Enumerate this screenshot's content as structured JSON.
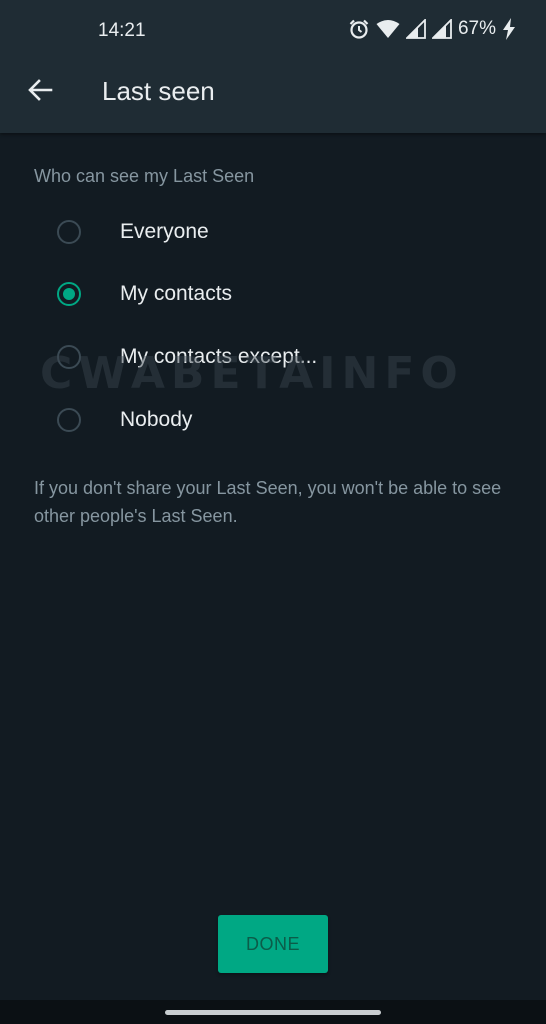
{
  "status_bar": {
    "time": "14:21",
    "battery": "67%",
    "icons": [
      "alarm-icon",
      "wifi-icon",
      "signal-icon",
      "signal-icon",
      "charging-icon"
    ]
  },
  "app_bar": {
    "title": "Last seen",
    "back_icon": "arrow-left-icon"
  },
  "section": {
    "label": "Who can see my Last Seen"
  },
  "options": [
    {
      "label": "Everyone",
      "selected": false
    },
    {
      "label": "My contacts",
      "selected": true
    },
    {
      "label": "My contacts except...",
      "selected": false
    },
    {
      "label": "Nobody",
      "selected": false
    }
  ],
  "footnote": "If you don't share your Last Seen, you won't be able to see other people's Last Seen.",
  "watermark": "CWABETAINFO",
  "done_button": "DONE",
  "colors": {
    "background": "#121b22",
    "header": "#1f2c34",
    "accent": "#00a884",
    "primary_text": "#e9edef",
    "secondary_text": "#8696a0"
  }
}
